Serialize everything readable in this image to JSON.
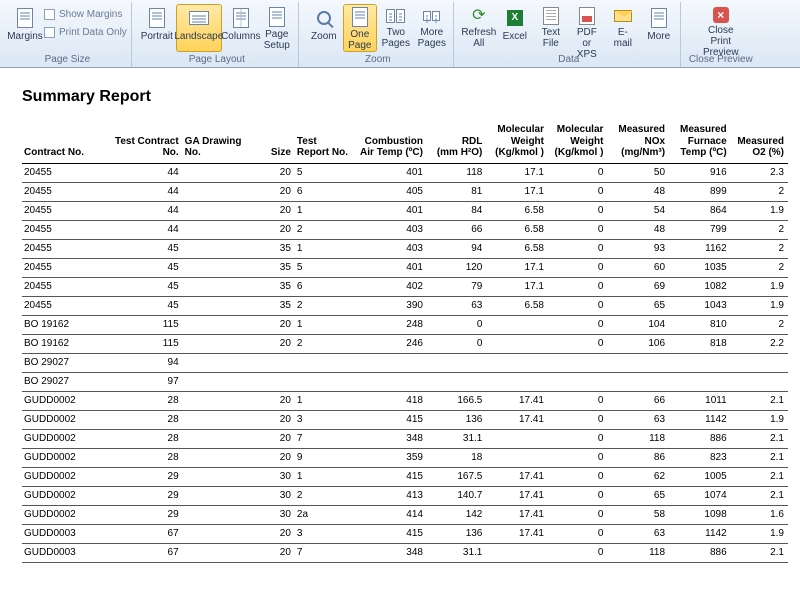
{
  "ribbon": {
    "page_size": {
      "group_label": "Page Size",
      "margins": "Margins",
      "show_margins": "Show Margins",
      "print_data_only": "Print Data Only"
    },
    "page_layout": {
      "group_label": "Page Layout",
      "portrait": "Portrait",
      "landscape": "Landscape",
      "columns": "Columns",
      "page_setup": "Page\nSetup"
    },
    "zoom": {
      "group_label": "Zoom",
      "zoom": "Zoom",
      "one_page": "One\nPage",
      "two_pages": "Two\nPages",
      "more_pages": "More\nPages"
    },
    "data": {
      "group_label": "Data",
      "refresh": "Refresh\nAll",
      "excel": "Excel",
      "text_file": "Text\nFile",
      "pdf": "PDF\nor XPS",
      "email": "E-mail",
      "more": "More"
    },
    "close": {
      "group_label": "Close Preview",
      "close_print_preview": "Close Print\nPreview"
    }
  },
  "report": {
    "title": "Summary Report",
    "columns": [
      "Contract No.",
      "Test Contract No.",
      "GA Drawing No.",
      "Size",
      "Test\nReport No.",
      "Combustion\nAir Temp (ºC)",
      "RDL\n(mm H²O)",
      "Molecular\nWeight\n(Kg/kmol )",
      "Molecular\nWeight\n(Kg/kmol )",
      "Measured\nNOx\n(mg/Nm³)",
      "Measured\nFurnace\nTemp (ºC)",
      "Measured\nO2 (%)"
    ],
    "rows": [
      [
        "20455",
        "44",
        "",
        "20",
        "5",
        "401",
        "118",
        "17.1",
        "0",
        "50",
        "916",
        "2.3"
      ],
      [
        "20455",
        "44",
        "",
        "20",
        "6",
        "405",
        "81",
        "17.1",
        "0",
        "48",
        "899",
        "2"
      ],
      [
        "20455",
        "44",
        "",
        "20",
        "1",
        "401",
        "84",
        "6.58",
        "0",
        "54",
        "864",
        "1.9"
      ],
      [
        "20455",
        "44",
        "",
        "20",
        "2",
        "403",
        "66",
        "6.58",
        "0",
        "48",
        "799",
        "2"
      ],
      [
        "20455",
        "45",
        "",
        "35",
        "1",
        "403",
        "94",
        "6.58",
        "0",
        "93",
        "1162",
        "2"
      ],
      [
        "20455",
        "45",
        "",
        "35",
        "5",
        "401",
        "120",
        "17.1",
        "0",
        "60",
        "1035",
        "2"
      ],
      [
        "20455",
        "45",
        "",
        "35",
        "6",
        "402",
        "79",
        "17.1",
        "0",
        "69",
        "1082",
        "1.9"
      ],
      [
        "20455",
        "45",
        "",
        "35",
        "2",
        "390",
        "63",
        "6.58",
        "0",
        "65",
        "1043",
        "1.9"
      ],
      [
        "BO 19162",
        "115",
        "",
        "20",
        "1",
        "248",
        "0",
        "",
        "0",
        "104",
        "810",
        "2"
      ],
      [
        "BO 19162",
        "115",
        "",
        "20",
        "2",
        "246",
        "0",
        "",
        "0",
        "106",
        "818",
        "2.2"
      ],
      [
        "BO 29027",
        "94",
        "",
        "",
        "",
        "",
        "",
        "",
        "",
        "",
        "",
        ""
      ],
      [
        "BO 29027",
        "97",
        "",
        "",
        "",
        "",
        "",
        "",
        "",
        "",
        "",
        ""
      ],
      [
        "GUDD0002",
        "28",
        "",
        "20",
        "1",
        "418",
        "166.5",
        "17.41",
        "0",
        "66",
        "1011",
        "2.1"
      ],
      [
        "GUDD0002",
        "28",
        "",
        "20",
        "3",
        "415",
        "136",
        "17.41",
        "0",
        "63",
        "1142",
        "1.9"
      ],
      [
        "GUDD0002",
        "28",
        "",
        "20",
        "7",
        "348",
        "31.1",
        "",
        "0",
        "118",
        "886",
        "2.1"
      ],
      [
        "GUDD0002",
        "28",
        "",
        "20",
        "9",
        "359",
        "18",
        "",
        "0",
        "86",
        "823",
        "2.1"
      ],
      [
        "GUDD0002",
        "29",
        "",
        "30",
        "1",
        "415",
        "167.5",
        "17.41",
        "0",
        "62",
        "1005",
        "2.1"
      ],
      [
        "GUDD0002",
        "29",
        "",
        "30",
        "2",
        "413",
        "140.7",
        "17.41",
        "0",
        "65",
        "1074",
        "2.1"
      ],
      [
        "GUDD0002",
        "29",
        "",
        "30",
        "2a",
        "414",
        "142",
        "17.41",
        "0",
        "58",
        "1098",
        "1.6"
      ],
      [
        "GUDD0003",
        "67",
        "",
        "20",
        "3",
        "415",
        "136",
        "17.41",
        "0",
        "63",
        "1142",
        "1.9"
      ],
      [
        "GUDD0003",
        "67",
        "",
        "20",
        "7",
        "348",
        "31.1",
        "",
        "0",
        "118",
        "886",
        "2.1"
      ]
    ]
  }
}
